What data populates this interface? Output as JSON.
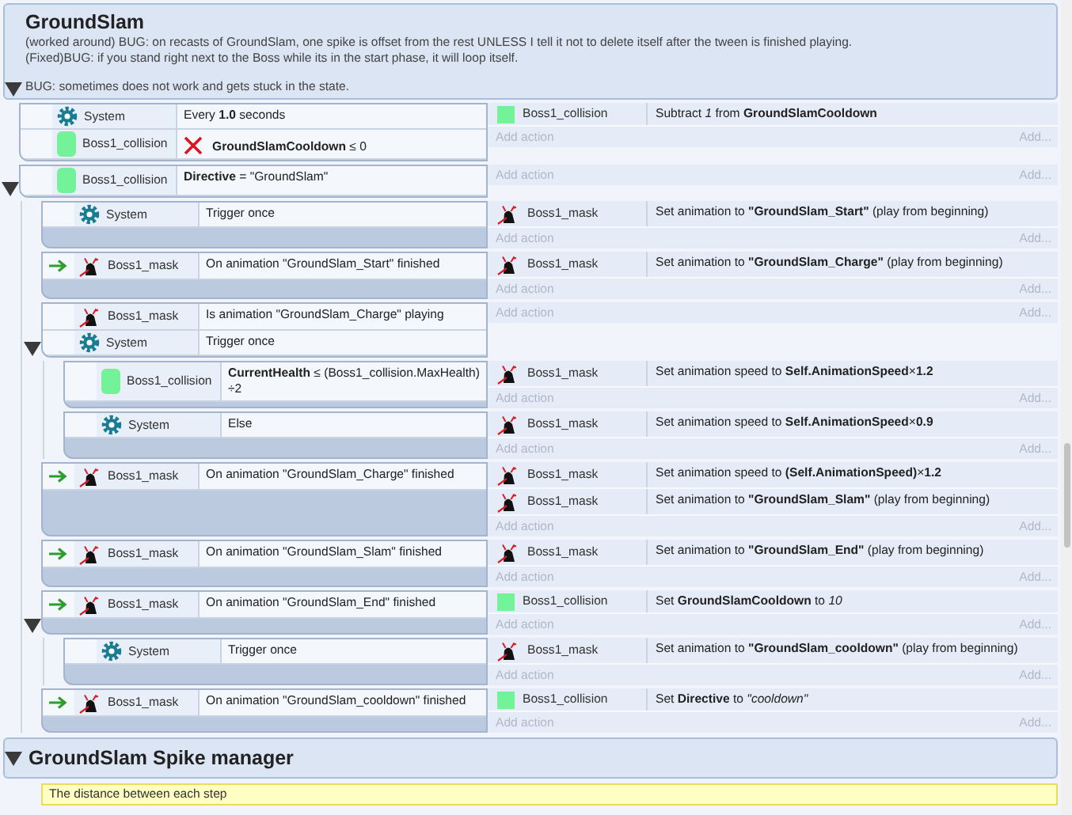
{
  "groups": [
    {
      "title": "GroundSlam",
      "expanded": true,
      "description": [
        [
          "(worked around) BUG: on recasts of GroundSlam, one spike is offset from the rest UNLESS I tell it not to delete itself after the tween is finished playing.",
          "(Fixed)BUG: if you stand right next to the Boss while its in the start phase, it will loop itself."
        ],
        [
          "BUG: sometimes does not work and gets stuck in the state."
        ]
      ],
      "events": [
        {
          "trigger": false,
          "conditions": [
            {
              "kind": "system",
              "object": "System",
              "text": "Every **1.0** seconds",
              "inverted": false
            },
            {
              "kind": "collision",
              "object": "Boss1_collision",
              "text": "**GroundSlamCooldown** ≤ 0",
              "inverted": true
            }
          ],
          "actions": [
            {
              "kind": "collision",
              "object": "Boss1_collision",
              "text": "Subtract *1* from **GroundSlamCooldown**"
            }
          ],
          "add_action": "Add action",
          "add_more": "Add..."
        },
        {
          "trigger": false,
          "expanded": true,
          "conditions": [
            {
              "kind": "collision",
              "object": "Boss1_collision",
              "text": "**Directive** = \"GroundSlam\"",
              "inverted": false
            }
          ],
          "add_action": "Add action",
          "add_more": "Add...",
          "children": [
            {
              "trigger": false,
              "conditions": [
                {
                  "kind": "system",
                  "object": "System",
                  "text": "Trigger once",
                  "inverted": false
                }
              ],
              "actions": [
                {
                  "kind": "mask",
                  "object": "Boss1_mask",
                  "text": "Set animation to **\"GroundSlam_Start\"** (play from beginning)"
                }
              ],
              "add_action": "Add action",
              "add_more": "Add..."
            },
            {
              "trigger": true,
              "conditions": [
                {
                  "kind": "mask",
                  "object": "Boss1_mask",
                  "text": "On animation \"GroundSlam_Start\" finished",
                  "inverted": false
                }
              ],
              "actions": [
                {
                  "kind": "mask",
                  "object": "Boss1_mask",
                  "text": "Set animation to **\"GroundSlam_Charge\"** (play from beginning)"
                }
              ],
              "add_action": "Add action",
              "add_more": "Add..."
            },
            {
              "trigger": false,
              "expanded": true,
              "conditions": [
                {
                  "kind": "mask",
                  "object": "Boss1_mask",
                  "text": "Is animation \"GroundSlam_Charge\" playing",
                  "inverted": false
                },
                {
                  "kind": "system",
                  "object": "System",
                  "text": "Trigger once",
                  "inverted": false
                }
              ],
              "add_action": "Add action",
              "add_more": "Add...",
              "children": [
                {
                  "trigger": false,
                  "conditions": [
                    {
                      "kind": "collision",
                      "object": "Boss1_collision",
                      "text": "**CurrentHealth** ≤ (Boss1_collision.MaxHealth) ÷2",
                      "inverted": false
                    }
                  ],
                  "actions": [
                    {
                      "kind": "mask",
                      "object": "Boss1_mask",
                      "text": "Set animation speed to **Self.AnimationSpeed**×**1.2**"
                    }
                  ],
                  "add_action": "Add action",
                  "add_more": "Add..."
                },
                {
                  "trigger": false,
                  "conditions": [
                    {
                      "kind": "system",
                      "object": "System",
                      "text": "Else",
                      "inverted": false
                    }
                  ],
                  "actions": [
                    {
                      "kind": "mask",
                      "object": "Boss1_mask",
                      "text": "Set animation speed to **Self.AnimationSpeed**×**0.9**"
                    }
                  ],
                  "add_action": "Add action",
                  "add_more": "Add..."
                }
              ]
            },
            {
              "trigger": true,
              "conditions": [
                {
                  "kind": "mask",
                  "object": "Boss1_mask",
                  "text": "On animation \"GroundSlam_Charge\" finished",
                  "inverted": false
                }
              ],
              "actions": [
                {
                  "kind": "mask",
                  "object": "Boss1_mask",
                  "text": "Set animation speed to **(Self.AnimationSpeed)**×**1.2**"
                },
                {
                  "kind": "mask",
                  "object": "Boss1_mask",
                  "text": "Set animation to **\"GroundSlam_Slam\"** (play from beginning)"
                }
              ],
              "add_action": "Add action",
              "add_more": "Add..."
            },
            {
              "trigger": true,
              "conditions": [
                {
                  "kind": "mask",
                  "object": "Boss1_mask",
                  "text": "On animation \"GroundSlam_Slam\" finished",
                  "inverted": false
                }
              ],
              "actions": [
                {
                  "kind": "mask",
                  "object": "Boss1_mask",
                  "text": "Set animation to **\"GroundSlam_End\"** (play from beginning)"
                }
              ],
              "add_action": "Add action",
              "add_more": "Add..."
            },
            {
              "trigger": true,
              "expanded": true,
              "conditions": [
                {
                  "kind": "mask",
                  "object": "Boss1_mask",
                  "text": "On animation \"GroundSlam_End\" finished",
                  "inverted": false
                }
              ],
              "actions": [
                {
                  "kind": "collision",
                  "object": "Boss1_collision",
                  "text": "Set **GroundSlamCooldown** to *10*"
                }
              ],
              "add_action": "Add action",
              "add_more": "Add...",
              "children": [
                {
                  "trigger": false,
                  "conditions": [
                    {
                      "kind": "system",
                      "object": "System",
                      "text": "Trigger once",
                      "inverted": false
                    }
                  ],
                  "actions": [
                    {
                      "kind": "mask",
                      "object": "Boss1_mask",
                      "text": "Set animation to **\"GroundSlam_cooldown\"** (play from beginning)"
                    }
                  ],
                  "add_action": "Add action",
                  "add_more": "Add..."
                }
              ]
            },
            {
              "trigger": true,
              "conditions": [
                {
                  "kind": "mask",
                  "object": "Boss1_mask",
                  "text": "On animation \"GroundSlam_cooldown\" finished",
                  "inverted": false
                }
              ],
              "actions": [
                {
                  "kind": "collision",
                  "object": "Boss1_collision",
                  "text": "Set **Directive** to *\"cooldown\"*"
                }
              ],
              "add_action": "Add action",
              "add_more": "Add..."
            }
          ]
        }
      ]
    },
    {
      "title": "GroundSlam Spike manager",
      "expanded": true,
      "comment": "The distance between each step"
    }
  ]
}
